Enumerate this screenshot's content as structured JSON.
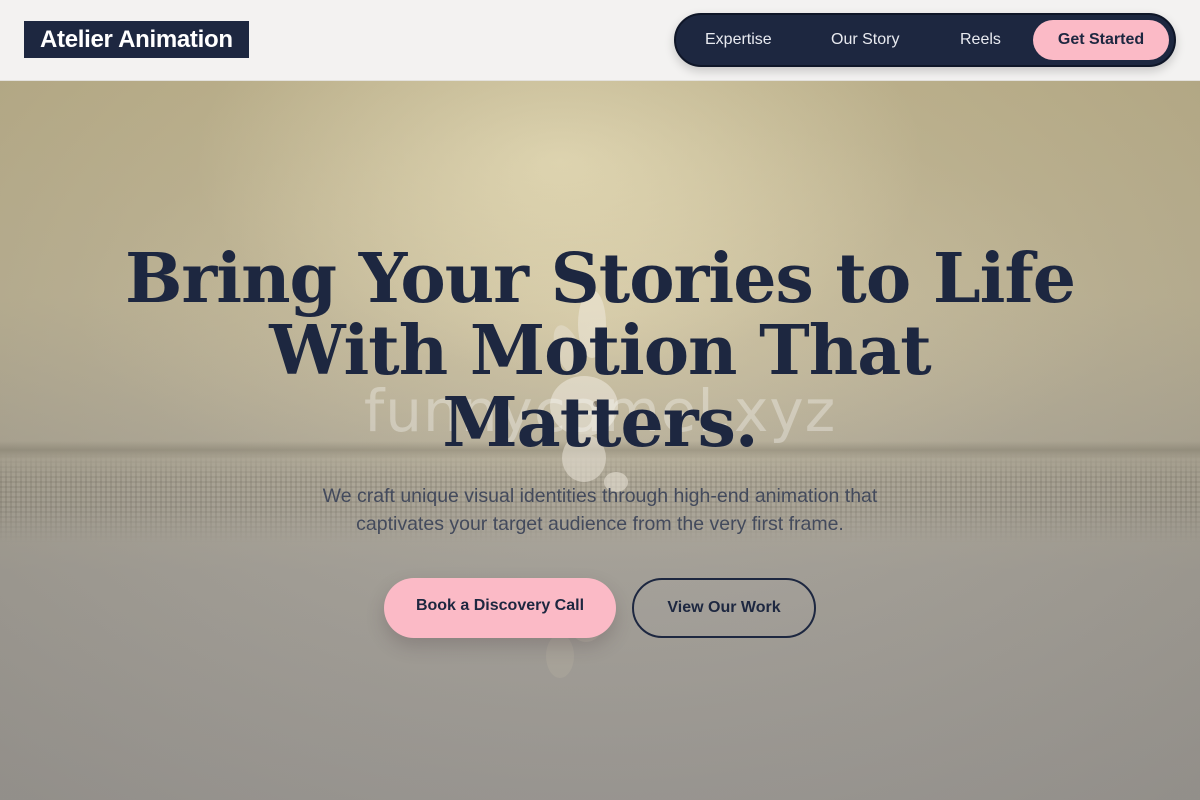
{
  "header": {
    "logo": "Atelier Animation",
    "nav": {
      "links": [
        "Expertise",
        "Our Story",
        "Reels"
      ],
      "cta": "Get Started"
    }
  },
  "hero": {
    "headline_line1": "Bring Your Stories to Life",
    "headline_line2": "With Motion That",
    "headline_line3": "Matters.",
    "subtext_line1": "We craft unique visual identities through high-end animation that",
    "subtext_line2": "captivates your target audience from the very first frame.",
    "primary_button": "Book a Discovery Call",
    "secondary_button": "View Our Work",
    "watermark": "funnycamel.xyz"
  },
  "colors": {
    "navy": "#1d2740",
    "pink": "#fbbac6",
    "header_bg": "#f3f2f1"
  }
}
